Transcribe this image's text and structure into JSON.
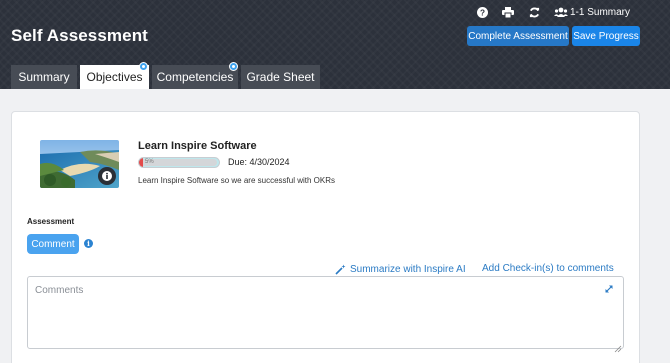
{
  "header": {
    "title": "Self Assessment",
    "icons": [
      "help-icon",
      "print-icon",
      "refresh-icon",
      "users-icon"
    ],
    "summary_link": "1-1 Summary",
    "complete_button": "Complete Assessment",
    "save_button": "Save Progress"
  },
  "tabs": [
    {
      "label": "Summary",
      "active": false,
      "badge": false
    },
    {
      "label": "Objectives",
      "active": true,
      "badge": true
    },
    {
      "label": "Competencies",
      "active": false,
      "badge": true
    },
    {
      "label": "Grade Sheet",
      "active": false,
      "badge": false
    }
  ],
  "objective": {
    "title": "Learn Inspire Software",
    "progress_text": "5%",
    "progress_value": 0.05,
    "due": "Due: 4/30/2024",
    "description": "Learn Inspire Software so we are successful with OKRs"
  },
  "assessment": {
    "label": "Assessment",
    "comment_button": "Comment",
    "summarize_link": "Summarize with Inspire AI",
    "checkin_link": "Add Check-in(s) to comments",
    "comments_placeholder": "Comments"
  },
  "colors": {
    "header_bg": "#2c313b",
    "primary": "#1a85e8",
    "link": "#2b7bc4",
    "progress_fill": "#e34b4b",
    "badge": "#3da2ef"
  }
}
